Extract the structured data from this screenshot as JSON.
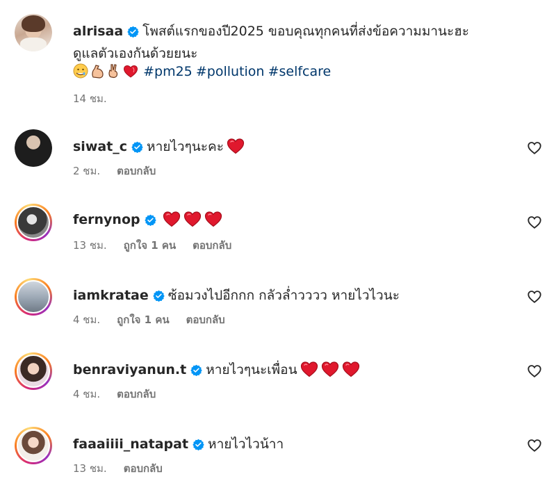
{
  "caption": {
    "username": "alrisaa",
    "line1": "โพสต์แรกของปี2025 ขอบคุณทุกคนที่ส่งข้อความมานะฮะ",
    "line2": "ดูแลตัวเองกันด้วยยนะ",
    "emojis": [
      "hot-face-icon",
      "flexed-biceps-icon",
      "victory-hand-icon",
      "heart-on-fire-icon"
    ],
    "hashtags": [
      "#pm25",
      "#pollution",
      "#selfcare"
    ],
    "time": "14 ชม."
  },
  "comments": [
    {
      "username": "siwat_c",
      "text": "หายไวๆนะคะ",
      "hearts": 1,
      "time": "2 ชม.",
      "likes": "",
      "reply": "ตอบกลับ",
      "ring": false
    },
    {
      "username": "fernynop",
      "text": "",
      "hearts": 3,
      "time": "13 ชม.",
      "likes": "ถูกใจ 1 คน",
      "reply": "ตอบกลับ",
      "ring": true
    },
    {
      "username": "iamkratae",
      "text": "ซ้อมวงไปอีกกก กลัวล่ำวววว หายไวไวนะ",
      "hearts": 0,
      "time": "4 ชม.",
      "likes": "ถูกใจ 1 คน",
      "reply": "ตอบกลับ",
      "ring": true
    },
    {
      "username": "benraviyanun.t",
      "text": "หายไวๆนะเพื่อน",
      "hearts": 3,
      "time": "4 ชม.",
      "likes": "",
      "reply": "ตอบกลับ",
      "ring": true
    },
    {
      "username": "faaaiiii_natapat",
      "text": "หายไวไวน้าา",
      "hearts": 0,
      "time": "13 ชม.",
      "likes": "",
      "reply": "ตอบกลับ",
      "ring": true
    }
  ],
  "colors": {
    "verified": "#0095f6",
    "heart": "#ed4956",
    "hashtag": "#00376b",
    "meta": "#737373"
  }
}
